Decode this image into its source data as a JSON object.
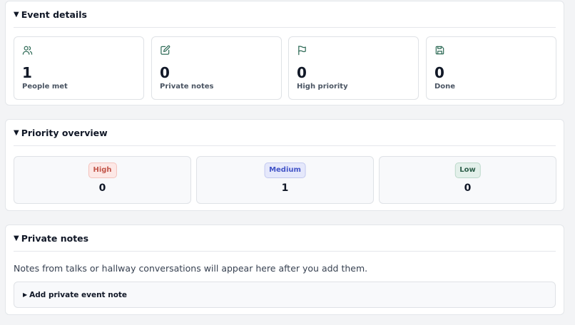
{
  "event_details": {
    "title": "Event details",
    "caret": "▼",
    "cards": [
      {
        "icon": "people-icon",
        "value": "1",
        "label": "People met"
      },
      {
        "icon": "edit-note-icon",
        "value": "0",
        "label": "Private notes"
      },
      {
        "icon": "flag-icon",
        "value": "0",
        "label": "High priority"
      },
      {
        "icon": "save-icon",
        "value": "0",
        "label": "Done"
      }
    ]
  },
  "priority_overview": {
    "title": "Priority overview",
    "caret": "▼",
    "items": [
      {
        "label": "High",
        "value": "0",
        "color": "#c2564a"
      },
      {
        "label": "Medium",
        "value": "1",
        "color": "#4355c7"
      },
      {
        "label": "Low",
        "value": "0",
        "color": "#2d5e4a"
      }
    ]
  },
  "private_notes": {
    "title": "Private notes",
    "caret": "▼",
    "empty_text": "Notes from talks or hallway conversations will appear here after you add them.",
    "add_caret": "▶",
    "add_label": "Add private event note"
  },
  "colors": {
    "icon_accent": "#2f6b57"
  }
}
